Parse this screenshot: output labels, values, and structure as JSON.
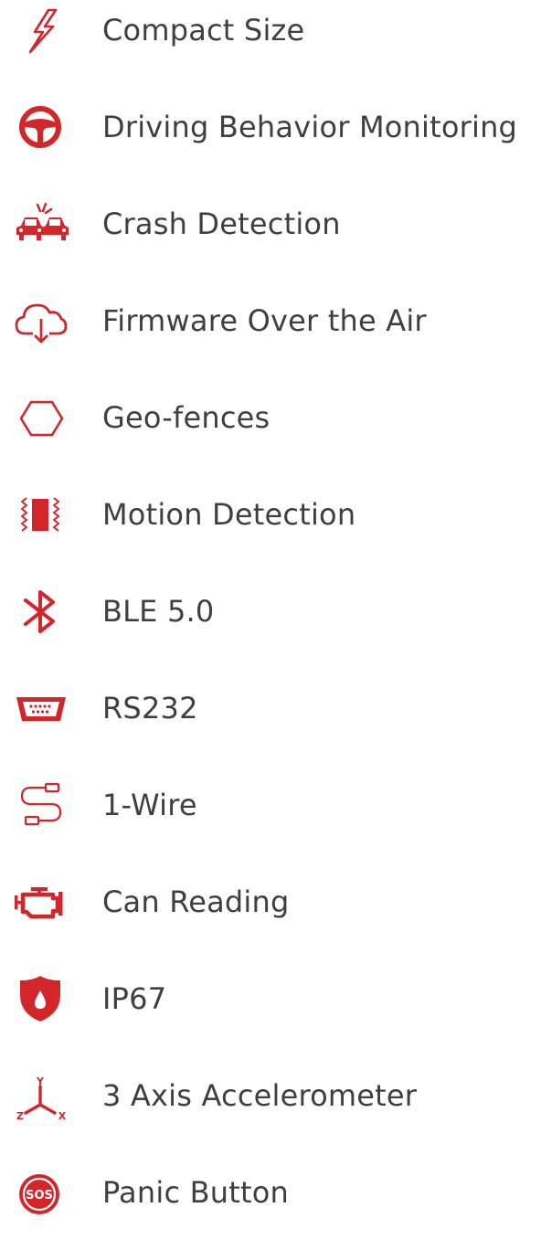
{
  "accent_color": "#d3262b",
  "text_color": "#3f3f3f",
  "features": [
    {
      "icon": "lightning-icon",
      "label": "Compact Size"
    },
    {
      "icon": "steering-wheel-icon",
      "label": "Driving Behavior Monitoring"
    },
    {
      "icon": "car-crash-icon",
      "label": "Crash Detection"
    },
    {
      "icon": "cloud-download-icon",
      "label": "Firmware Over the Air"
    },
    {
      "icon": "hexagon-icon",
      "label": "Geo-fences"
    },
    {
      "icon": "vibration-icon",
      "label": "Motion Detection"
    },
    {
      "icon": "bluetooth-icon",
      "label": "BLE 5.0"
    },
    {
      "icon": "serial-port-icon",
      "label": "RS232"
    },
    {
      "icon": "wire-icon",
      "label": "1-Wire"
    },
    {
      "icon": "engine-icon",
      "label": "Can Reading"
    },
    {
      "icon": "shield-drop-icon",
      "label": "IP67"
    },
    {
      "icon": "axis-icon",
      "label": "3 Axis Accelerometer",
      "axis_letters": [
        "Y",
        "Z",
        "X"
      ]
    },
    {
      "icon": "sos-icon",
      "label": "Panic Button",
      "badge_text": "SOS"
    }
  ]
}
